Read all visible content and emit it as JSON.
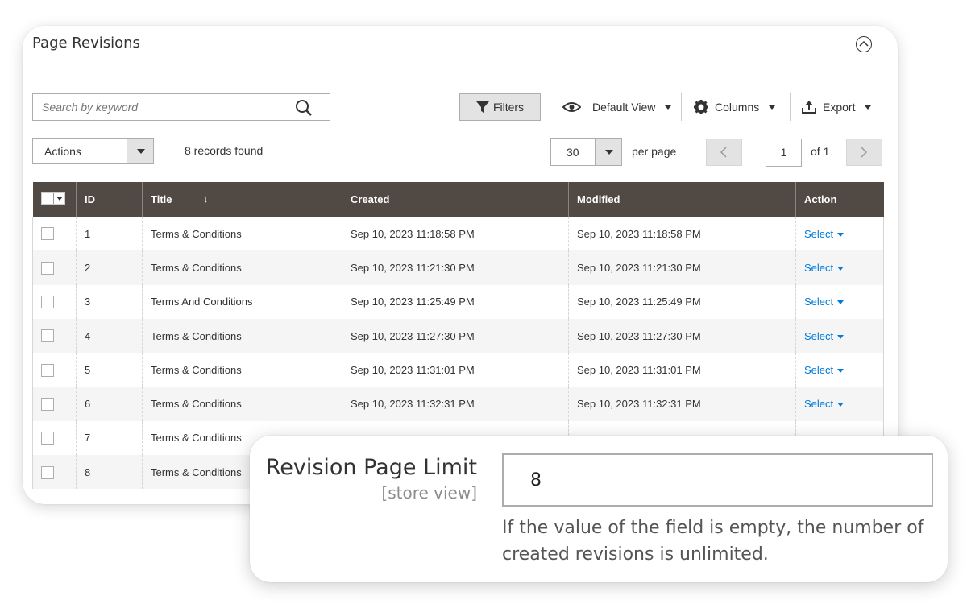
{
  "panel": {
    "title": "Page Revisions"
  },
  "toolbar": {
    "search_placeholder": "Search by keyword",
    "filters_label": "Filters",
    "default_view_label": "Default View",
    "columns_label": "Columns",
    "export_label": "Export"
  },
  "grid_controls": {
    "actions_label": "Actions",
    "records_found": "8 records found",
    "per_page_value": "30",
    "per_page_label": "per page",
    "current_page": "1",
    "page_of": "of 1"
  },
  "table": {
    "columns": [
      "ID",
      "Title",
      "Created",
      "Modified",
      "Action"
    ],
    "rows": [
      {
        "id": "1",
        "title": "Terms & Conditions",
        "created": "Sep 10, 2023 11:18:58 PM",
        "modified": "Sep 10, 2023 11:18:58 PM",
        "action": "Select"
      },
      {
        "id": "2",
        "title": "Terms & Conditions",
        "created": "Sep 10, 2023 11:21:30 PM",
        "modified": "Sep 10, 2023 11:21:30 PM",
        "action": "Select"
      },
      {
        "id": "3",
        "title": "Terms And Conditions",
        "created": "Sep 10, 2023 11:25:49 PM",
        "modified": "Sep 10, 2023 11:25:49 PM",
        "action": "Select"
      },
      {
        "id": "4",
        "title": "Terms & Conditions",
        "created": "Sep 10, 2023 11:27:30 PM",
        "modified": "Sep 10, 2023 11:27:30 PM",
        "action": "Select"
      },
      {
        "id": "5",
        "title": "Terms & Conditions",
        "created": "Sep 10, 2023 11:31:01 PM",
        "modified": "Sep 10, 2023 11:31:01 PM",
        "action": "Select"
      },
      {
        "id": "6",
        "title": "Terms & Conditions",
        "created": "Sep 10, 2023 11:32:31 PM",
        "modified": "Sep 10, 2023 11:32:31 PM",
        "action": "Select"
      },
      {
        "id": "7",
        "title": "Terms & Conditions",
        "created": "",
        "modified": "",
        "action": ""
      },
      {
        "id": "8",
        "title": "Terms & Conditions",
        "created": "",
        "modified": "",
        "action": ""
      }
    ]
  },
  "setting": {
    "label": "Revision Page Limit",
    "scope": "[store view]",
    "value": "8",
    "note": "If the value of the field is empty, the number of created revisions is unlimited."
  },
  "colors": {
    "header_bg": "#514943",
    "link": "#007bdb",
    "button_bg": "#e3e3e3"
  },
  "icons": {
    "search": "search-icon",
    "filter": "filter-icon",
    "eye": "eye-icon",
    "gear": "gear-icon",
    "export": "export-icon",
    "collapse": "chevron-up-circle-icon"
  }
}
